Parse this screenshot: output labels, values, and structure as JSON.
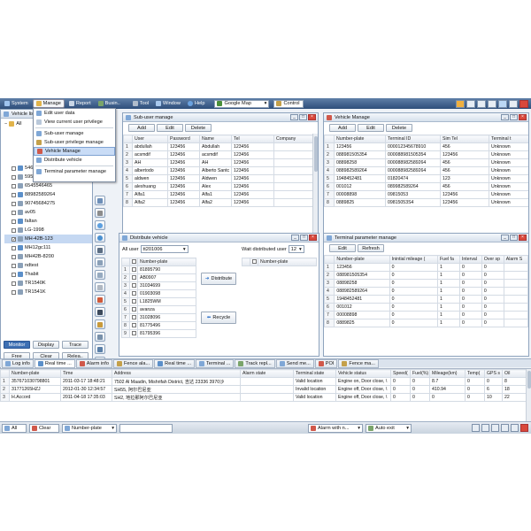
{
  "menubar": {
    "items": [
      {
        "label": "System",
        "icon": "gear-icon"
      },
      {
        "label": "Manage",
        "icon": "folder-icon"
      },
      {
        "label": "Report",
        "icon": "report-icon"
      },
      {
        "label": "Busin..",
        "icon": "briefcase-icon"
      },
      {
        "label": "Tool",
        "icon": "wrench-icon"
      },
      {
        "label": "Window",
        "icon": "window-icon"
      },
      {
        "label": "Help",
        "icon": "help-icon"
      }
    ],
    "map_select": "Google Map",
    "control_label": "Control"
  },
  "manage_menu": {
    "items": [
      "Edit user data",
      "View current user privilege",
      "Sub-user manage",
      "Sub-user privilege manage",
      "Vehicle Manage",
      "Distribute vehicle",
      "Terminal parameter manage"
    ]
  },
  "tree": {
    "title": "Vehicle list",
    "root": "All",
    "items": [
      "54645643573457",
      "595981505350850",
      "6545546465",
      "88982589264",
      "90745684275",
      "av05",
      "faltan",
      "LG-1998",
      "MH-42B-123",
      "MH12gc111",
      "MH42B-8200",
      "ndtest",
      "Thabit",
      "TR1540K",
      "TR1541K"
    ],
    "selected": "MH-42B-123",
    "buttons": {
      "monitor": "Monitor",
      "display": "Display",
      "trace": "Trace",
      "free": "Free",
      "clear": "Clear",
      "release": "Relea.."
    }
  },
  "subuser": {
    "title": "Sub-user manage",
    "toolbar": {
      "add": "Add",
      "edit": "Edit",
      "delete": "Delete"
    },
    "columns": [
      "",
      "User",
      "Password",
      "Name",
      "Tel",
      "Company"
    ],
    "rows": [
      [
        "1",
        "abdullah",
        "123456",
        "Abdullah",
        "123456",
        ""
      ],
      [
        "2",
        "acsmdif",
        "123456",
        "acsmdif",
        "123456",
        ""
      ],
      [
        "3",
        "AH",
        "123456",
        "AH",
        "123456",
        ""
      ],
      [
        "4",
        "albertodo",
        "123456",
        "Alberto Santc",
        "123456",
        ""
      ],
      [
        "5",
        "aldwen",
        "123456",
        "Aldwen",
        "123456",
        ""
      ],
      [
        "6",
        "aleshuang",
        "123456",
        "Alex",
        "123456",
        ""
      ],
      [
        "7",
        "Alfa1",
        "123456",
        "Alfa1",
        "123456",
        ""
      ],
      [
        "8",
        "Alfa2",
        "123456",
        "Alfa2",
        "123456",
        ""
      ]
    ]
  },
  "vehicle_manage": {
    "title": "Vehicle Manage",
    "toolbar": {
      "add": "Add",
      "edit": "Edit",
      "delete": "Delete"
    },
    "columns": [
      "",
      "Number-plate",
      "Terminal ID",
      "Sim Tel",
      "Terminal t"
    ],
    "rows": [
      [
        "1",
        "123456",
        "000012345678910",
        "456",
        "Unknown"
      ],
      [
        "2",
        "088981505354",
        "000088981505354",
        "123456",
        "Unknown"
      ],
      [
        "3",
        "08898258",
        "000088982589264",
        "456",
        "Unknown"
      ],
      [
        "4",
        "088982589264",
        "000088982589264",
        "456",
        "Unknown"
      ],
      [
        "5",
        "1948452481",
        "01820474",
        "123",
        "Unknown"
      ],
      [
        "6",
        "001012",
        "089982589264",
        "456",
        "Unknown"
      ],
      [
        "7",
        "00008898",
        "09815053",
        "123456",
        "Unknown"
      ],
      [
        "8",
        "0889825",
        "09815053S4",
        "123456",
        "Unknown"
      ]
    ]
  },
  "distribute": {
    "title": "Distribute vehicle",
    "all_user_label": "All user",
    "all_user_value": "tt201006",
    "wait_label": "Wait distributed user",
    "wait_value": "12",
    "left_header": "Number-plate",
    "right_header": "Number-plate",
    "left_rows": [
      [
        "1",
        "81895790"
      ],
      [
        "2",
        "AB0907"
      ],
      [
        "3",
        "31034699"
      ],
      [
        "4",
        "01903098"
      ],
      [
        "5",
        "L1825WM"
      ],
      [
        "6",
        "avanza"
      ],
      [
        "7",
        "31028096"
      ],
      [
        "8",
        "81775496"
      ],
      [
        "9",
        "81795396"
      ]
    ],
    "distribute_btn": "Distribute",
    "recycle_btn": "Recycle"
  },
  "terminal_param": {
    "title": "Terminal parameter manage",
    "toolbar": {
      "edit": "Edit",
      "refresh": "Refresh"
    },
    "columns": [
      "",
      "Number-plate",
      "Inintial mileage (",
      "Fuel fa",
      "Interval",
      "Over sp",
      "Alarm S"
    ],
    "rows": [
      [
        "1",
        "123456",
        "0",
        "1",
        "0",
        "0",
        ""
      ],
      [
        "2",
        "088981505354",
        "0",
        "1",
        "0",
        "0",
        ""
      ],
      [
        "3",
        "08898258",
        "0",
        "1",
        "0",
        "0",
        ""
      ],
      [
        "4",
        "088982589264",
        "0",
        "1",
        "0",
        "0",
        ""
      ],
      [
        "5",
        "1948452481",
        "0",
        "1",
        "0",
        "0",
        ""
      ],
      [
        "6",
        "001012",
        "0",
        "1",
        "0",
        "0",
        ""
      ],
      [
        "7",
        "00008898",
        "0",
        "1",
        "0",
        "0",
        ""
      ],
      [
        "8",
        "0889825",
        "0",
        "1",
        "0",
        "0",
        ""
      ]
    ]
  },
  "bottom_tabs": [
    "Log info",
    "Real time ...",
    "Alarm info",
    "Fence ala...",
    "Real time ...",
    "Terminal ...",
    "Track repl...",
    "Send me...",
    "POI",
    "Fence ma..."
  ],
  "realtime": {
    "columns": [
      "",
      "Number-plate",
      "Time",
      "Address",
      "Alarm state",
      "Terminal state",
      "Vehicle status",
      "Speed(",
      "Fuel(%)",
      "Mileage(km)",
      "Temp(",
      "GPS s",
      "Oil"
    ],
    "rows": [
      [
        "1",
        "357671030798801",
        "2011-03-17 18:48:21",
        "7502 Al Maadin, Mishrifah District, 吉达 23336 3970沙",
        "",
        "Valid location",
        "Engine on, Door close, \\",
        "0",
        "0",
        "8.7",
        "0",
        "0",
        "8"
      ],
      [
        "2",
        "31771265HZJ",
        "2012-01-30 12:34:57",
        "SH55, 阿尔巴尼亚",
        "",
        "Invalid location",
        "Engine off, Door close, \\",
        "0",
        "0",
        "410.94",
        "0",
        "6",
        "18"
      ],
      [
        "3",
        "H.Accord",
        "2011-04-18 17:35:03",
        "SH2, 地拉那阿尔巴尼亚",
        "",
        "Valid location",
        "Engine off, Door close, \\",
        "0",
        "0",
        "0",
        "0",
        "10",
        "22"
      ]
    ]
  },
  "statusbar": {
    "all_label": "All",
    "clear_label": "Clear",
    "filter_select": "Number-plate",
    "alarm_select": "Alarm with n...",
    "auto_exit": "Auto exit"
  },
  "colors": {
    "menubar": "#2e4e7a",
    "panel_border": "#8ea3bd",
    "selection": "#c5d8f2",
    "close_button": "#d9483b",
    "monitor_button": "#3d6fb3"
  }
}
